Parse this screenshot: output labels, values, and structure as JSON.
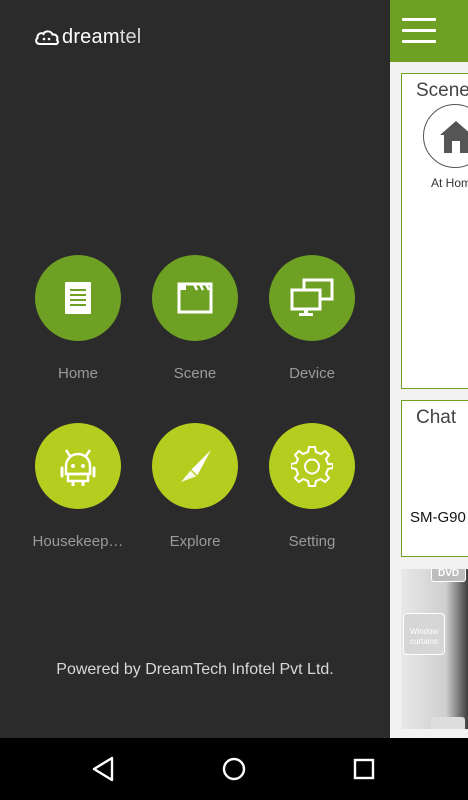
{
  "app": {
    "logo_text_bold": "dream",
    "logo_text_light": "tel"
  },
  "menu": {
    "items": [
      {
        "label": "Home",
        "icon": "document-icon",
        "style": "dark"
      },
      {
        "label": "Scene",
        "icon": "clapperboard-icon",
        "style": "dark"
      },
      {
        "label": "Device",
        "icon": "monitors-icon",
        "style": "dark"
      },
      {
        "label": "Housekeep…",
        "icon": "robot-icon",
        "style": "lime"
      },
      {
        "label": "Explore",
        "icon": "compass-icon",
        "style": "lime"
      },
      {
        "label": "Setting",
        "icon": "gear-icon",
        "style": "lime"
      }
    ]
  },
  "footer": {
    "powered_by": "Powered by DreamTech Infotel Pvt Ltd."
  },
  "main": {
    "scene_card": {
      "title": "Scene",
      "item_label": "At Home",
      "item_icon": "house-icon"
    },
    "chat_card": {
      "title": "Chat",
      "device": "SM-G90"
    },
    "photo": {
      "tag": "DVD",
      "button": "Window curtains"
    }
  },
  "colors": {
    "drawer_bg": "#2b2b2b",
    "accent_dark": "#6ea024",
    "accent_lime": "#b4cd1f",
    "label_gray": "#9a9a9a"
  },
  "navbar": {
    "buttons": [
      "back-icon",
      "home-circle-icon",
      "recents-icon"
    ]
  }
}
